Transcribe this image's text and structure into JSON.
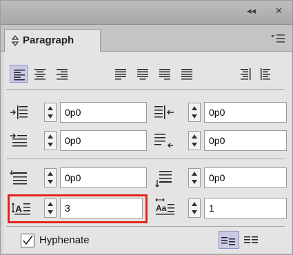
{
  "window": {
    "collapse_icon": "double-chevron-left-icon",
    "close_icon": "close-icon",
    "collapse_glyph": "◂◂",
    "close_glyph": "✕"
  },
  "tab": {
    "label": "Paragraph",
    "menu_icon": "panel-menu-icon"
  },
  "alignment": {
    "buttons": [
      {
        "name": "align-left",
        "active": true
      },
      {
        "name": "align-center",
        "active": false
      },
      {
        "name": "align-right",
        "active": false
      },
      {
        "name": "justify-left",
        "active": false
      },
      {
        "name": "justify-center",
        "active": false
      },
      {
        "name": "justify-right",
        "active": false
      },
      {
        "name": "justify-all",
        "active": false
      },
      {
        "name": "align-towards-spine",
        "active": false
      },
      {
        "name": "align-away-from-spine",
        "active": false
      }
    ]
  },
  "fields": {
    "left_indent": "0p0",
    "right_indent": "0p0",
    "first_line_indent": "0p0",
    "last_line_right_indent": "0p0",
    "space_before": "0p0",
    "space_after": "0p0",
    "drop_cap_lines": "3",
    "drop_cap_characters": "1"
  },
  "hyphenate": {
    "label": "Hyphenate",
    "checked": true
  },
  "colors": {
    "highlight": "#e2231a",
    "active_button": "#c9cbe6"
  }
}
